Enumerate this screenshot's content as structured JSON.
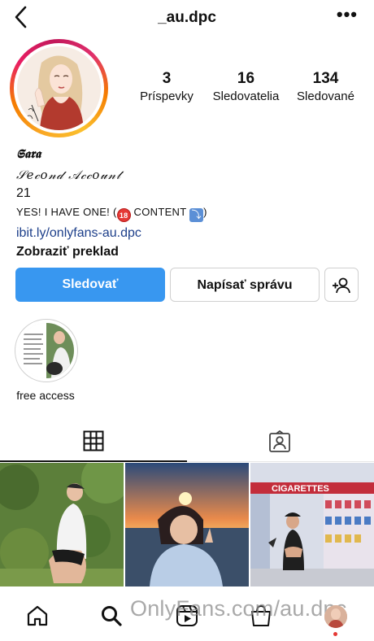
{
  "header": {
    "username": "_au.dpc",
    "back_icon": "chevron-left-icon",
    "more_icon": "more-dots-icon",
    "more_glyph": "•••"
  },
  "profile": {
    "stats": [
      {
        "value": "3",
        "label": "Príspevky"
      },
      {
        "value": "16",
        "label": "Sledovatelia"
      },
      {
        "value": "134",
        "label": "Sledované"
      }
    ],
    "display_name": "𝕾𝖆𝖗𝖆",
    "tagline": "𝒮𝑒𝒸𝑜𝓃𝒹 𝒜𝒸𝒸𝑜𝓊𝓃𝓉",
    "age": "21",
    "bio_before": "YES! I HAVE ONE! (",
    "badge_18": "18",
    "bio_middle": " CONTENT ",
    "arrow_glyph": "⤵",
    "bio_after": ")",
    "link": "ibit.ly/onlyfans-au.dpc",
    "translate": "Zobraziť preklad"
  },
  "actions": {
    "follow": "Sledovať",
    "message": "Napísať správu",
    "add_user_icon": "add-person-icon"
  },
  "highlight": {
    "label": "free access"
  },
  "tabs": [
    {
      "icon": "grid-icon",
      "active": true
    },
    {
      "icon": "tagged-person-icon",
      "active": false
    }
  ],
  "bottom_nav": {
    "items": [
      "home-icon",
      "search-icon",
      "reels-icon",
      "shop-icon",
      "profile-avatar"
    ],
    "watermark": "OnlyFans.com/au.dpc"
  },
  "posts": [
    {
      "caption": ""
    },
    {
      "caption": ""
    },
    {
      "sign_text": "CIGARETTES"
    }
  ],
  "colors": {
    "accent": "#3897f0",
    "link": "#1d3f8a"
  }
}
